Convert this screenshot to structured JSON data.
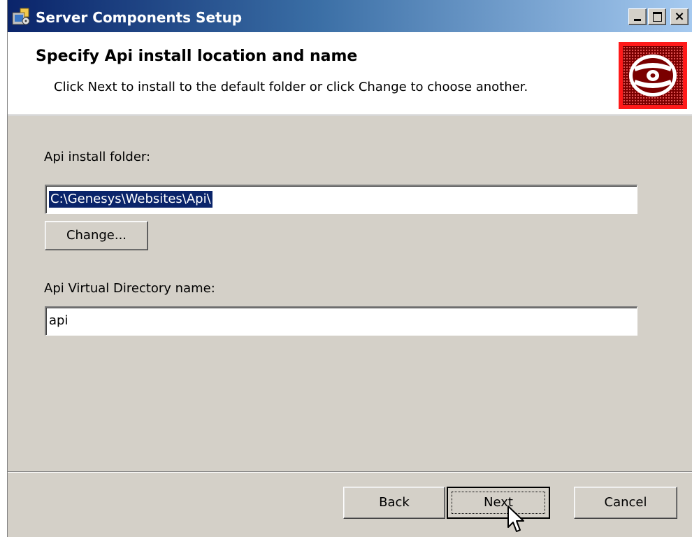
{
  "window": {
    "title": "Server Components Setup",
    "icon": "installer-icon",
    "controls": {
      "minimize": "minimize-icon",
      "maximize": "maximize-icon",
      "close": "×"
    }
  },
  "banner": {
    "title": "Specify Api install location and name",
    "description": "Click Next to install to the default folder or click Change to choose another.",
    "logo": "disc-icon",
    "logo_colors": {
      "border": "#ff1a1a",
      "background": "#7a0000"
    }
  },
  "form": {
    "folder_label": "Api install folder:",
    "folder_value": "C:\\Genesys\\Websites\\Api\\",
    "change_label": "Change...",
    "vdir_label": "Api Virtual Directory name:",
    "vdir_value": "api"
  },
  "footer": {
    "back_label": "Back",
    "next_label": "Next",
    "cancel_label": "Cancel"
  },
  "colors": {
    "dialog_face": "#d4d0c8",
    "title_gradient_start": "#0a246a",
    "title_gradient_end": "#a6caf0",
    "selection": "#0a246a"
  }
}
